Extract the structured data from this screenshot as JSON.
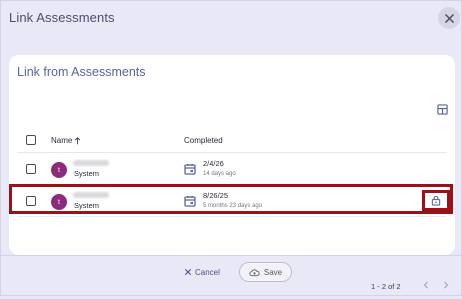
{
  "dialog": {
    "title": "Link Assessments"
  },
  "card": {
    "title": "Link from Assessments"
  },
  "table": {
    "columns": {
      "name": "Name",
      "completed": "Completed"
    },
    "rows": [
      {
        "avatar_letter": "t",
        "subtitle": "System",
        "date": "2/4/26",
        "ago": "14 days ago"
      },
      {
        "avatar_letter": "t",
        "subtitle": "System",
        "date": "8/26/25",
        "ago": "5 months 23 days ago"
      }
    ]
  },
  "pagination": {
    "range_text": "1 - 2 of 2"
  },
  "footer": {
    "cancel_label": "Cancel",
    "save_label": "Save"
  },
  "colors": {
    "accent": "#5b63a6",
    "avatar": "#8e2a7c",
    "highlight": "#9c1119",
    "background": "#e9e8f7"
  },
  "icons": [
    "close-icon",
    "column-grid-icon",
    "sort-arrow-up-icon",
    "calendar-icon",
    "lock-icon",
    "chevron-left-icon",
    "chevron-right-icon",
    "cloud-save-icon"
  ]
}
